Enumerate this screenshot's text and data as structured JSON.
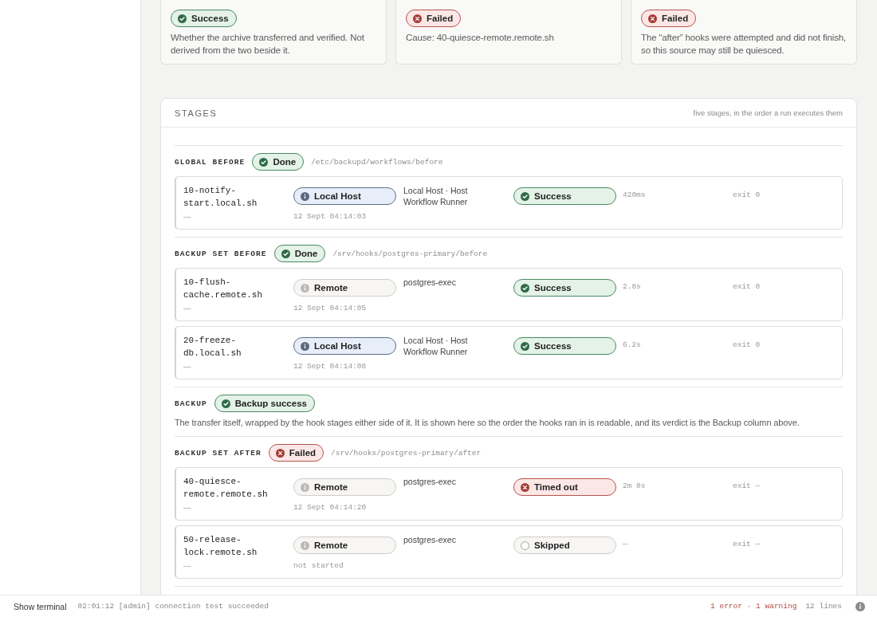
{
  "summary_cards": [
    {
      "status": {
        "label": "Success",
        "kind": "success"
      },
      "description": "Whether the archive transferred and verified. Not derived from the two beside it."
    },
    {
      "status": {
        "label": "Failed",
        "kind": "failed"
      },
      "description": "Cause: 40-quiesce-remote.remote.sh"
    },
    {
      "status": {
        "label": "Failed",
        "kind": "failed"
      },
      "description": "The “after” hooks were attempted and did not finish, so this source may still be quiesced."
    }
  ],
  "stages_panel": {
    "title": "STAGES",
    "note": "five stages, in the order a run executes them",
    "stages": [
      {
        "kind": "hooks",
        "name": "GLOBAL BEFORE",
        "status": {
          "label": "Done",
          "kind": "success"
        },
        "path": "/etc/backupd/workflows/before",
        "hooks": [
          {
            "script": "10-notify-start.local.sh",
            "note": "—",
            "target": {
              "label": "Local Host",
              "kind": "local"
            },
            "runner": "Local Host · Host Workflow Runner",
            "started": "12 Sept 04:14:03",
            "result": {
              "label": "Success",
              "kind": "success"
            },
            "duration": "420ms",
            "exit": "exit 0"
          }
        ]
      },
      {
        "kind": "hooks",
        "name": "BACKUP SET BEFORE",
        "status": {
          "label": "Done",
          "kind": "success"
        },
        "path": "/srv/hooks/postgres-primary/before",
        "hooks": [
          {
            "script": "10-flush-cache.remote.sh",
            "note": "—",
            "target": {
              "label": "Remote",
              "kind": "remote"
            },
            "runner": "postgres-exec",
            "started": "12 Sept 04:14:05",
            "result": {
              "label": "Success",
              "kind": "success"
            },
            "duration": "2.8s",
            "exit": "exit 0"
          },
          {
            "script": "20-freeze-db.local.sh",
            "note": "—",
            "target": {
              "label": "Local Host",
              "kind": "local"
            },
            "runner": "Local Host · Host Workflow Runner",
            "started": "12 Sept 04:14:08",
            "result": {
              "label": "Success",
              "kind": "success"
            },
            "duration": "6.2s",
            "exit": "exit 0"
          }
        ]
      },
      {
        "kind": "transfer",
        "name": "BACKUP",
        "status": {
          "label": "Backup success",
          "kind": "success"
        },
        "description": "The transfer itself, wrapped by the hook stages either side of it. It is shown here so the order the hooks ran in is readable, and its verdict is the Backup column above."
      },
      {
        "kind": "hooks",
        "name": "BACKUP SET AFTER",
        "status": {
          "label": "Failed",
          "kind": "failed"
        },
        "path": "/srv/hooks/postgres-primary/after",
        "hooks": [
          {
            "script": "40-quiesce-remote.remote.sh",
            "note": "—",
            "target": {
              "label": "Remote",
              "kind": "remote"
            },
            "runner": "postgres-exec",
            "started": "12 Sept 04:14:20",
            "result": {
              "label": "Timed out",
              "kind": "failed"
            },
            "duration": "2m 0s",
            "exit": "exit —"
          },
          {
            "script": "50-release-lock.remote.sh",
            "note": "—",
            "target": {
              "label": "Remote",
              "kind": "remote"
            },
            "runner": "postgres-exec",
            "started": "not started",
            "result": {
              "label": "Skipped",
              "kind": "skipped"
            },
            "duration": "—",
            "exit": "exit —"
          }
        ]
      }
    ]
  },
  "terminal_bar": {
    "toggle": "Show terminal",
    "last_line": "02:01:12 [admin] connection test succeeded",
    "problems": "1 error · 1 warning",
    "line_count": "12 lines"
  }
}
